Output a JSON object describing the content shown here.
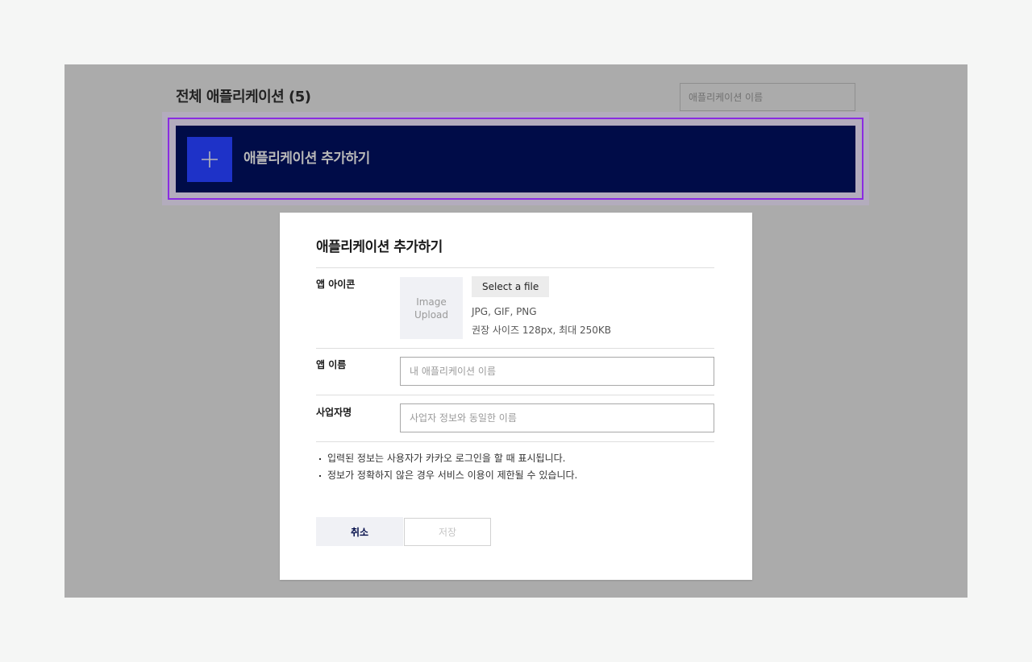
{
  "page": {
    "title": "전체 애플리케이션 (5)",
    "search_placeholder": "애플리케이션 이름"
  },
  "banner": {
    "label": "애플리케이션 추가하기",
    "icon": "plus-icon"
  },
  "modal": {
    "title": "애플리케이션 추가하기",
    "icon_row": {
      "label": "앱 아이콘",
      "upload_line1": "Image",
      "upload_line2": "Upload",
      "select_file": "Select a file",
      "hint_formats": "JPG, GIF, PNG",
      "hint_size": "권장 사이즈 128px, 최대 250KB"
    },
    "name_row": {
      "label": "앱 이름",
      "placeholder": "내 애플리케이션 이름"
    },
    "company_row": {
      "label": "사업자명",
      "placeholder": "사업자 정보와 동일한 이름"
    },
    "notes": [
      "입력된 정보는 사용자가 카카오 로그인을 할 때 표시됩니다.",
      "정보가 정확하지 않은 경우 서비스 이용이 제한될 수 있습니다."
    ],
    "cancel_label": "취소",
    "save_label": "저장"
  },
  "colors": {
    "banner_bg": "#000c48",
    "plus_bg": "#1e32c8",
    "highlight": "#8a2be2",
    "overlay": "#ababab"
  }
}
